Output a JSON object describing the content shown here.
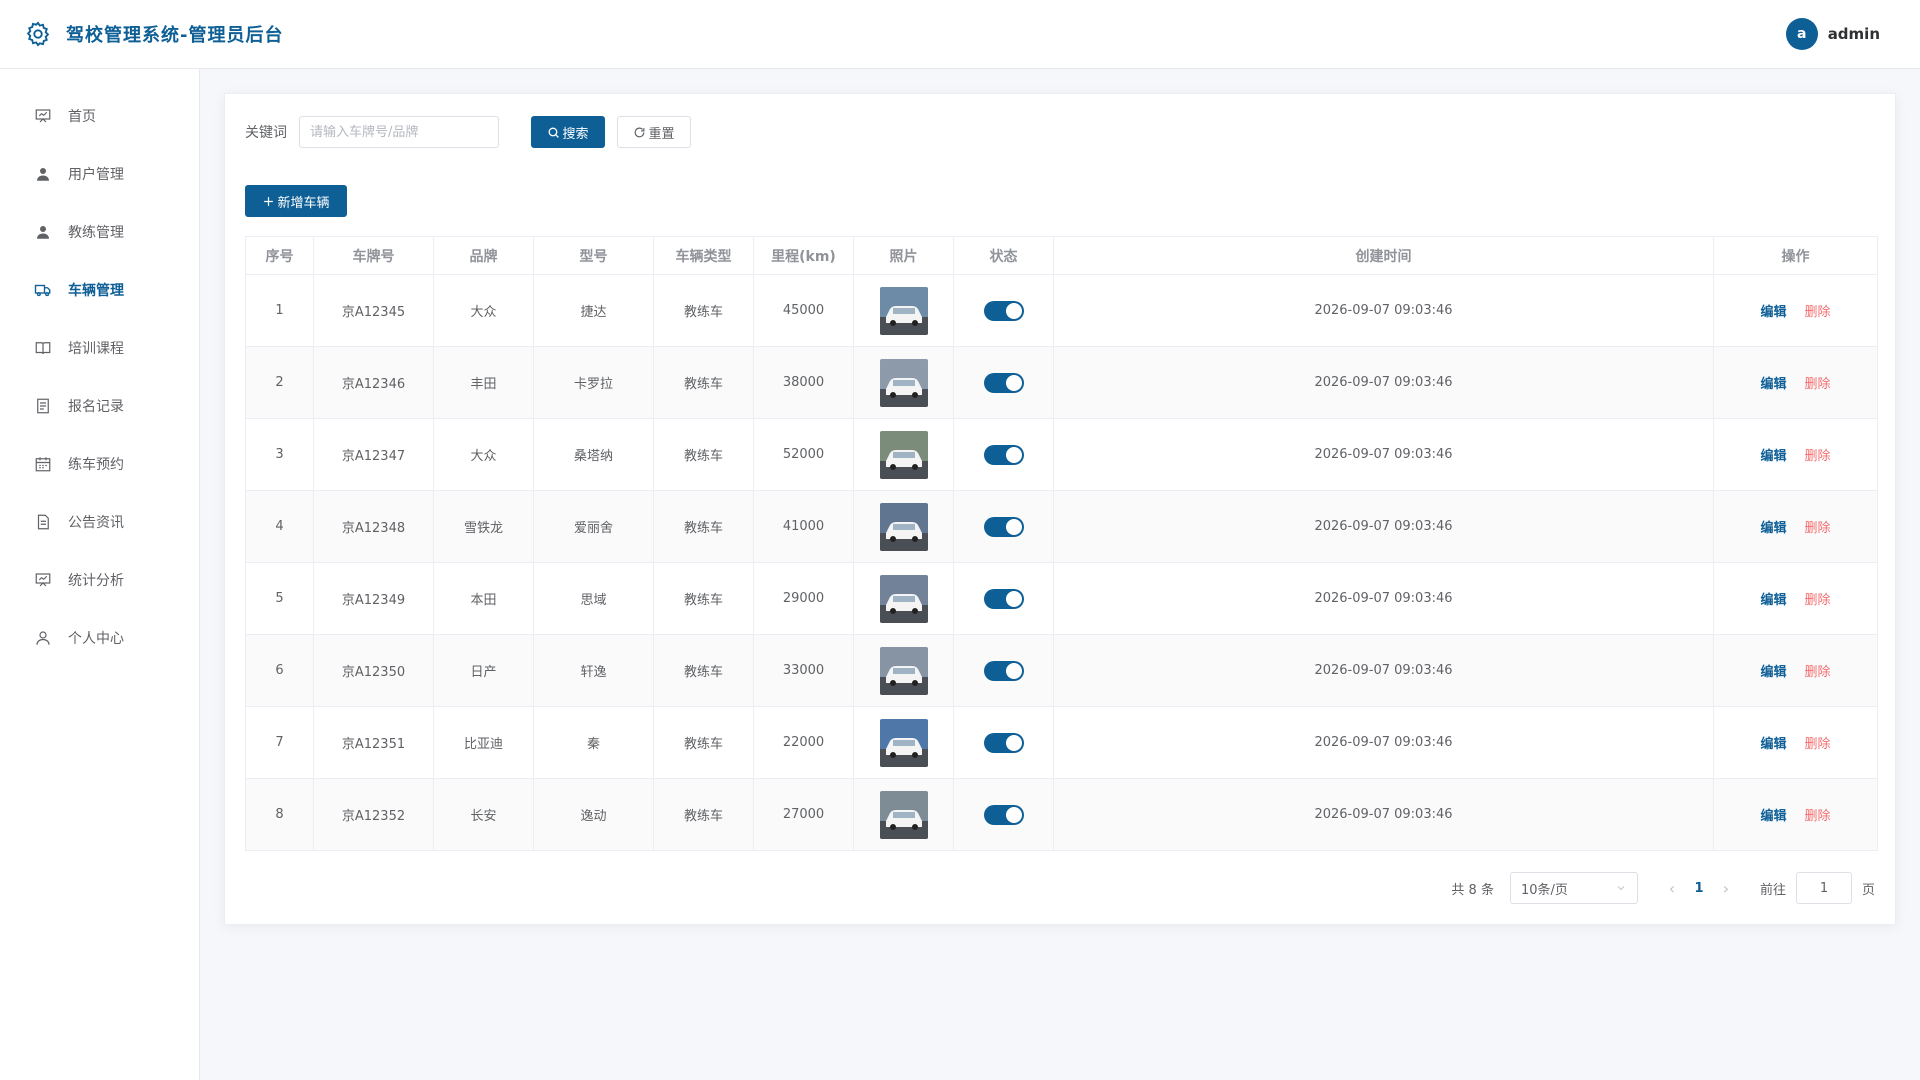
{
  "header": {
    "title": "驾校管理系统-管理员后台",
    "avatar_letter": "a",
    "username": "admin"
  },
  "sidebar": {
    "items": [
      {
        "label": "首页",
        "icon": "presentation-icon",
        "active": false
      },
      {
        "label": "用户管理",
        "icon": "user-icon",
        "active": false
      },
      {
        "label": "教练管理",
        "icon": "user-icon",
        "active": false
      },
      {
        "label": "车辆管理",
        "icon": "truck-icon",
        "active": true
      },
      {
        "label": "培训课程",
        "icon": "book-icon",
        "active": false
      },
      {
        "label": "报名记录",
        "icon": "document-icon",
        "active": false
      },
      {
        "label": "练车预约",
        "icon": "calendar-icon",
        "active": false
      },
      {
        "label": "公告资讯",
        "icon": "document-icon",
        "active": false
      },
      {
        "label": "统计分析",
        "icon": "presentation-icon",
        "active": false
      },
      {
        "label": "个人中心",
        "icon": "user-outline-icon",
        "active": false
      }
    ]
  },
  "search": {
    "label": "关键词",
    "placeholder": "请输入车牌号/品牌",
    "value": "",
    "search_label": "搜索",
    "reset_label": "重置"
  },
  "toolbar": {
    "add_label": "新增车辆"
  },
  "table": {
    "columns": [
      "序号",
      "车牌号",
      "品牌",
      "型号",
      "车辆类型",
      "里程(km)",
      "照片",
      "状态",
      "创建时间",
      "操作"
    ],
    "edit_label": "编辑",
    "delete_label": "删除",
    "rows": [
      {
        "index": "1",
        "plate": "京A12345",
        "brand": "大众",
        "model": "捷达",
        "type": "教练车",
        "mileage": "45000",
        "status_on": true,
        "created": "2026-09-07 09:03:46"
      },
      {
        "index": "2",
        "plate": "京A12346",
        "brand": "丰田",
        "model": "卡罗拉",
        "type": "教练车",
        "mileage": "38000",
        "status_on": true,
        "created": "2026-09-07 09:03:46"
      },
      {
        "index": "3",
        "plate": "京A12347",
        "brand": "大众",
        "model": "桑塔纳",
        "type": "教练车",
        "mileage": "52000",
        "status_on": true,
        "created": "2026-09-07 09:03:46"
      },
      {
        "index": "4",
        "plate": "京A12348",
        "brand": "雪铁龙",
        "model": "爱丽舍",
        "type": "教练车",
        "mileage": "41000",
        "status_on": true,
        "created": "2026-09-07 09:03:46"
      },
      {
        "index": "5",
        "plate": "京A12349",
        "brand": "本田",
        "model": "思域",
        "type": "教练车",
        "mileage": "29000",
        "status_on": true,
        "created": "2026-09-07 09:03:46"
      },
      {
        "index": "6",
        "plate": "京A12350",
        "brand": "日产",
        "model": "轩逸",
        "type": "教练车",
        "mileage": "33000",
        "status_on": true,
        "created": "2026-09-07 09:03:46"
      },
      {
        "index": "7",
        "plate": "京A12351",
        "brand": "比亚迪",
        "model": "秦",
        "type": "教练车",
        "mileage": "22000",
        "status_on": true,
        "created": "2026-09-07 09:03:46"
      },
      {
        "index": "8",
        "plate": "京A12352",
        "brand": "长安",
        "model": "逸动",
        "type": "教练车",
        "mileage": "27000",
        "status_on": true,
        "created": "2026-09-07 09:03:46"
      }
    ]
  },
  "pagination": {
    "total_text": "共 8 条",
    "page_size": "10条/页",
    "current_page": "1",
    "goto_label": "前往",
    "goto_value": "1",
    "page_unit": "页"
  },
  "colors": {
    "accent": "#0e5f96",
    "danger": "#f56c6c"
  }
}
